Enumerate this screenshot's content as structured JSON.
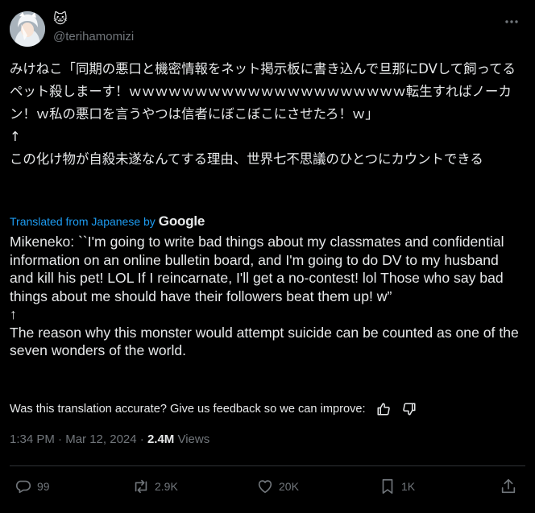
{
  "tweet": {
    "display_name": "🐱",
    "handle": "@terihamomizi",
    "text_original": "みけねこ「同期の悪口と機密情報をネット掲示板に書き込んで旦那にDVして飼ってるペット殺しまーす！ｗｗｗｗｗｗｗｗｗｗｗｗｗｗｗｗｗｗｗｗｗ転生すればノーカン！ｗ私の悪口を言うやつは信者にぼこぼこにさせたろ！ｗ」\n↑\nこの化け物が自殺未遂なんてする理由、世界七不思議のひとつにカウントできる",
    "translated_from": "Translated from Japanese by",
    "translator": "Google",
    "text_translated": "Mikeneko: ``I'm going to write bad things about my classmates and confidential information on an online bulletin board, and I'm going to do DV to my husband and kill his pet! LOL If I reincarnate, I'll get a no-contest! lol Those who say bad things about me should have their followers beat them up! w”\n↑\nThe reason why this monster would attempt suicide can be counted as one of the seven wonders of the world.",
    "feedback_prompt": "Was this translation accurate? Give us feedback so we can improve:",
    "time": "1:34 PM",
    "separator": " · ",
    "date": "Mar 12, 2024",
    "views_count": "2.4M",
    "views_label": "Views"
  },
  "actions": {
    "replies": "99",
    "reposts": "2.9K",
    "likes": "20K",
    "bookmarks": "1K"
  },
  "icons": {
    "more": "more-dots-icon",
    "thumbs_up": "thumbs-up-icon",
    "thumbs_down": "thumbs-down-icon",
    "reply": "reply-bubble-icon",
    "repost": "repost-arrows-icon",
    "like": "heart-icon",
    "bookmark": "bookmark-icon",
    "share": "share-upload-icon"
  },
  "colors": {
    "background": "#000000",
    "text": "#e7e9ea",
    "muted": "#71767b",
    "link": "#1d9bf0",
    "divider": "#2f3336"
  }
}
